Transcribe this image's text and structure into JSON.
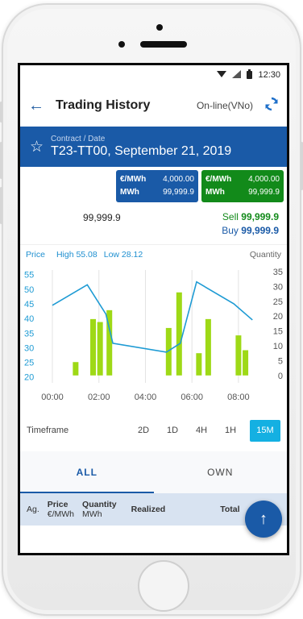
{
  "status": {
    "time": "12:30"
  },
  "header": {
    "title": "Trading History",
    "connection": "On-line(VNo)"
  },
  "contract": {
    "label": "Contract / Date",
    "value": "T23-TT00, September 21, 2019"
  },
  "quotes": [
    {
      "unit1": "€/MWh",
      "price": "4,000.00",
      "unit2": "MWh",
      "qty": "99,999.9",
      "color": "#1a5aa7"
    },
    {
      "unit1": "€/MWh",
      "price": "4,000.00",
      "unit2": "MWh",
      "qty": "99,999.9",
      "color": "#128a1a"
    }
  ],
  "summary": {
    "left_value": "99,999.9",
    "sell_label": "Sell",
    "sell_value": "99,999.9",
    "buy_label": "Buy",
    "buy_value": "99,999.9"
  },
  "chart_header": {
    "price_label": "Price",
    "high": "High 55.08",
    "low": "Low 28.12",
    "quantity_label": "Quantity"
  },
  "chart_data": {
    "type": "bar",
    "x_ticks": [
      "00:00",
      "02:00",
      "04:00",
      "06:00",
      "08:00"
    ],
    "y_left_ticks": [
      55,
      50,
      45,
      40,
      35,
      30,
      25,
      20
    ],
    "y_right_ticks": [
      35,
      30,
      25,
      20,
      15,
      10,
      5,
      0
    ],
    "ylim_left": [
      18,
      56
    ],
    "ylim_right": [
      -2.5,
      35
    ],
    "xlim": [
      0,
      8.8
    ],
    "series": [
      {
        "kind": "bar",
        "axis": "right",
        "color": "#9ed916",
        "x": [
          1.0,
          1.75,
          2.05,
          2.45,
          5.0,
          5.45,
          6.3,
          6.7,
          8.0,
          8.3
        ],
        "values": [
          4.5,
          19,
          18,
          22,
          16,
          28,
          7.5,
          19,
          13.5,
          8.5
        ]
      },
      {
        "kind": "line",
        "axis": "left",
        "color": "#1e9bd4",
        "x": [
          0,
          1.5,
          2.3,
          2.6,
          4.9,
          5.5,
          6.2,
          7.8,
          8.6
        ],
        "values": [
          44.5,
          51.5,
          41.5,
          31.5,
          28.5,
          31.5,
          52.5,
          45,
          39.5
        ]
      }
    ]
  },
  "timeframe": {
    "label": "Timeframe",
    "options": [
      "2D",
      "1D",
      "4H",
      "1H",
      "15M"
    ],
    "selected": "15M"
  },
  "tabs": {
    "all": "ALL",
    "own": "OWN"
  },
  "table": {
    "ag": "Ag.",
    "price": "Price",
    "price_unit": "€/MWh",
    "quantity": "Quantity",
    "quantity_unit": "MWh",
    "realized": "Realized",
    "total": "Total"
  }
}
